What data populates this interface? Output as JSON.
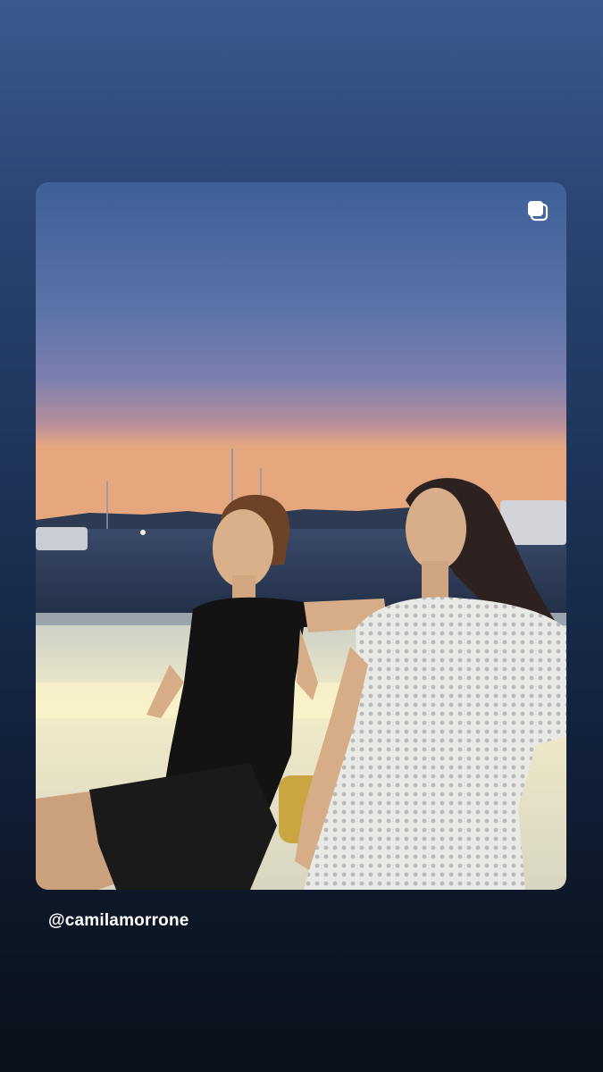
{
  "story": {
    "mention": "@camilamorrone",
    "card_icon": "multiple-posts-icon"
  },
  "colors": {
    "background_top": "#3a5a8e",
    "background_bottom": "#0a111c",
    "mention_text": "#ffffff"
  }
}
